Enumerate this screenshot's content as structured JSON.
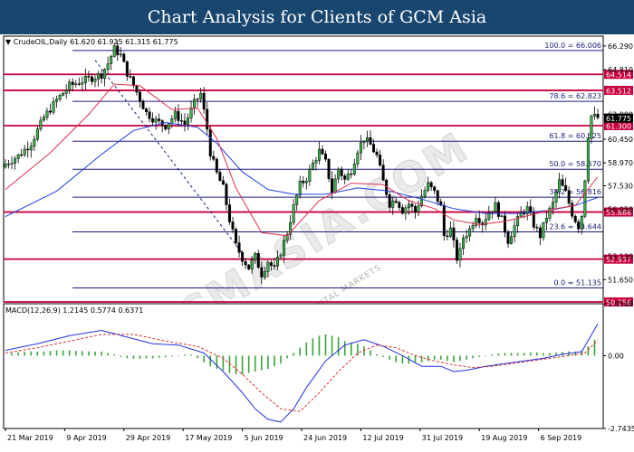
{
  "header": {
    "title": "Chart Analysis for Clients of GCM Asia"
  },
  "watermark": {
    "text": "GCMASIA.COM",
    "subtext": "GLOBAL CAPITAL MARKETS"
  },
  "chart_data": [
    {
      "type": "candlestick",
      "symbol_info": "CrudeOIL,Daily  61.620 61.915 61.315 61.775",
      "x_tick_labels": [
        "21 Mar 2019",
        "9 Apr 2019",
        "29 Apr 2019",
        "17 May 2019",
        "5 Jun 2019",
        "24 Jun 2019",
        "12 Jul 2019",
        "31 Jul 2019",
        "19 Aug 2019",
        "6 Sep 2019"
      ],
      "ylim": [
        50.256,
        66.906
      ],
      "y_tick_labels": [
        {
          "v": 66.29,
          "label": "66.290"
        },
        {
          "v": 64.81,
          "label": "64.810"
        },
        {
          "v": 62.0,
          "label": "62.000"
        },
        {
          "v": 60.45,
          "label": "60.450"
        },
        {
          "v": 58.97,
          "label": "58.970"
        },
        {
          "v": 57.53,
          "label": "57.530"
        },
        {
          "v": 56.05,
          "label": "56.050"
        },
        {
          "v": 53.13,
          "label": "53.130"
        },
        {
          "v": 51.65,
          "label": "51.650"
        }
      ],
      "current_price": {
        "v": 61.775,
        "label": "61.775",
        "color": "#000000"
      },
      "fib_levels": [
        {
          "v": 66.006,
          "label": "100.0 = 66.006"
        },
        {
          "v": 62.823,
          "label": "78.6 = 62.823"
        },
        {
          "v": 60.325,
          "label": "61.8 = 60.325"
        },
        {
          "v": 58.57,
          "label": "50.0 = 58.570"
        },
        {
          "v": 56.816,
          "label": "38.2 = 56.816"
        },
        {
          "v": 54.644,
          "label": "23.6 = 54.644"
        },
        {
          "v": 51.135,
          "label": "0.0 = 51.135"
        }
      ],
      "sr_levels": [
        {
          "v": 64.514,
          "label": "64.514"
        },
        {
          "v": 63.512,
          "label": "63.512"
        },
        {
          "v": 61.3,
          "label": "61.300"
        },
        {
          "v": 55.888,
          "label": "55.888"
        },
        {
          "v": 52.937,
          "label": "52.937"
        },
        {
          "v": 50.256,
          "label": "50.256"
        }
      ],
      "close_path": [
        [
          0,
          58.9
        ],
        [
          4,
          59.4
        ],
        [
          8,
          60.2
        ],
        [
          12,
          61.8
        ],
        [
          16,
          62.9
        ],
        [
          20,
          63.8
        ],
        [
          24,
          64.1
        ],
        [
          27,
          64.3
        ],
        [
          30,
          64.5
        ],
        [
          32,
          65.2
        ],
        [
          34,
          66.1
        ],
        [
          36,
          65.7
        ],
        [
          38,
          64.6
        ],
        [
          41,
          63.4
        ],
        [
          44,
          62.1
        ],
        [
          47,
          61.6
        ],
        [
          50,
          61.3
        ],
        [
          53,
          62.0
        ],
        [
          56,
          61.4
        ],
        [
          59,
          62.7
        ],
        [
          61,
          63.3
        ],
        [
          62,
          62.2
        ],
        [
          63,
          61.1
        ],
        [
          64,
          59.6
        ],
        [
          66,
          58.3
        ],
        [
          68,
          57.4
        ],
        [
          70,
          55.4
        ],
        [
          72,
          53.8
        ],
        [
          74,
          53.0
        ],
        [
          76,
          52.4
        ],
        [
          78,
          53.1
        ],
        [
          80,
          52.0
        ],
        [
          82,
          52.8
        ],
        [
          84,
          52.3
        ],
        [
          86,
          53.4
        ],
        [
          88,
          54.6
        ],
        [
          90,
          56.2
        ],
        [
          92,
          57.6
        ],
        [
          94,
          58.0
        ],
        [
          96,
          58.9
        ],
        [
          98,
          59.7
        ],
        [
          100,
          59.0
        ],
        [
          102,
          57.2
        ],
        [
          104,
          58.6
        ],
        [
          106,
          57.9
        ],
        [
          108,
          58.5
        ],
        [
          110,
          59.8
        ],
        [
          112,
          60.5
        ],
        [
          114,
          60.1
        ],
        [
          116,
          59.4
        ],
        [
          118,
          57.8
        ],
        [
          120,
          56.4
        ],
        [
          122,
          56.7
        ],
        [
          124,
          56.0
        ],
        [
          126,
          56.4
        ],
        [
          128,
          55.9
        ],
        [
          130,
          56.9
        ],
        [
          132,
          57.6
        ],
        [
          134,
          57.1
        ],
        [
          136,
          56.2
        ],
        [
          137,
          54.4
        ],
        [
          139,
          54.8
        ],
        [
          141,
          53.0
        ],
        [
          142,
          53.4
        ],
        [
          143,
          54.3
        ],
        [
          145,
          54.8
        ],
        [
          147,
          55.7
        ],
        [
          149,
          55.2
        ],
        [
          151,
          55.9
        ],
        [
          153,
          56.3
        ],
        [
          155,
          55.4
        ],
        [
          157,
          54.1
        ],
        [
          159,
          55.0
        ],
        [
          161,
          55.8
        ],
        [
          163,
          56.1
        ],
        [
          165,
          55.1
        ],
        [
          167,
          54.4
        ],
        [
          169,
          55.6
        ],
        [
          171,
          56.4
        ],
        [
          173,
          57.8
        ],
        [
          175,
          57.1
        ],
        [
          177,
          55.8
        ],
        [
          179,
          55.0
        ],
        [
          180,
          55.7
        ],
        [
          181,
          58.0
        ],
        [
          182,
          60.7
        ],
        [
          183,
          61.9
        ],
        [
          185,
          61.8
        ]
      ],
      "ma_red": [
        [
          0,
          57.3
        ],
        [
          14,
          59.6
        ],
        [
          26,
          62.0
        ],
        [
          34,
          63.9
        ],
        [
          42,
          63.8
        ],
        [
          52,
          62.3
        ],
        [
          60,
          62.4
        ],
        [
          66,
          60.5
        ],
        [
          72,
          57.4
        ],
        [
          80,
          54.6
        ],
        [
          88,
          54.4
        ],
        [
          98,
          56.6
        ],
        [
          108,
          57.7
        ],
        [
          118,
          57.6
        ],
        [
          126,
          56.6
        ],
        [
          134,
          56.1
        ],
        [
          140,
          55.4
        ],
        [
          148,
          55.1
        ],
        [
          156,
          55.3
        ],
        [
          164,
          55.7
        ],
        [
          172,
          56.1
        ],
        [
          178,
          56.3
        ],
        [
          185,
          58.1
        ]
      ],
      "ma_blue": [
        [
          0,
          55.6
        ],
        [
          16,
          57.2
        ],
        [
          30,
          59.5
        ],
        [
          40,
          61.0
        ],
        [
          50,
          61.5
        ],
        [
          60,
          61.2
        ],
        [
          66,
          60.2
        ],
        [
          74,
          58.4
        ],
        [
          82,
          57.3
        ],
        [
          90,
          57.0
        ],
        [
          100,
          57.0
        ],
        [
          110,
          57.4
        ],
        [
          120,
          57.2
        ],
        [
          130,
          56.7
        ],
        [
          140,
          56.1
        ],
        [
          150,
          55.8
        ],
        [
          160,
          55.8
        ],
        [
          170,
          56.0
        ],
        [
          178,
          56.3
        ],
        [
          185,
          56.8
        ]
      ],
      "dashed_trend": [
        [
          28,
          65.4
        ],
        [
          74,
          53.3
        ]
      ]
    },
    {
      "type": "macd",
      "label": "MACD(12,26,9) 1.2145 0.5774 0.6371",
      "ylim": [
        -2.7435,
        1.9548
      ],
      "y_tick_labels": [
        {
          "v": 1.9548,
          "label": "1.9548"
        },
        {
          "v": 0.0,
          "label": "0.00"
        },
        {
          "v": -2.7435,
          "label": "-2.7435"
        }
      ],
      "macd": [
        [
          0,
          0.2
        ],
        [
          10,
          0.45
        ],
        [
          20,
          0.75
        ],
        [
          30,
          0.95
        ],
        [
          38,
          0.7
        ],
        [
          46,
          0.45
        ],
        [
          54,
          0.4
        ],
        [
          62,
          0.1
        ],
        [
          68,
          -0.6
        ],
        [
          74,
          -1.4
        ],
        [
          78,
          -2.0
        ],
        [
          82,
          -2.4
        ],
        [
          86,
          -2.5
        ],
        [
          90,
          -2.0
        ],
        [
          94,
          -1.2
        ],
        [
          100,
          -0.2
        ],
        [
          106,
          0.4
        ],
        [
          112,
          0.6
        ],
        [
          118,
          0.35
        ],
        [
          124,
          0.0
        ],
        [
          130,
          -0.4
        ],
        [
          136,
          -0.4
        ],
        [
          140,
          -0.6
        ],
        [
          144,
          -0.55
        ],
        [
          150,
          -0.4
        ],
        [
          156,
          -0.3
        ],
        [
          162,
          -0.2
        ],
        [
          168,
          -0.1
        ],
        [
          174,
          0.05
        ],
        [
          180,
          0.15
        ],
        [
          185,
          1.2
        ]
      ],
      "signal": [
        [
          0,
          0.1
        ],
        [
          10,
          0.3
        ],
        [
          20,
          0.55
        ],
        [
          30,
          0.8
        ],
        [
          40,
          0.8
        ],
        [
          50,
          0.55
        ],
        [
          60,
          0.35
        ],
        [
          68,
          -0.1
        ],
        [
          74,
          -0.7
        ],
        [
          80,
          -1.4
        ],
        [
          86,
          -2.0
        ],
        [
          92,
          -2.1
        ],
        [
          98,
          -1.4
        ],
        [
          104,
          -0.6
        ],
        [
          110,
          0.1
        ],
        [
          116,
          0.4
        ],
        [
          122,
          0.3
        ],
        [
          128,
          0.0
        ],
        [
          134,
          -0.2
        ],
        [
          140,
          -0.35
        ],
        [
          146,
          -0.45
        ],
        [
          152,
          -0.4
        ],
        [
          158,
          -0.3
        ],
        [
          164,
          -0.2
        ],
        [
          170,
          -0.1
        ],
        [
          176,
          0.0
        ],
        [
          181,
          0.1
        ],
        [
          185,
          0.58
        ]
      ],
      "histogram": [
        [
          2,
          0.1
        ],
        [
          4,
          0.12
        ],
        [
          6,
          0.14
        ],
        [
          8,
          0.16
        ],
        [
          10,
          0.15
        ],
        [
          12,
          0.16
        ],
        [
          14,
          0.18
        ],
        [
          16,
          0.2
        ],
        [
          18,
          0.2
        ],
        [
          20,
          0.2
        ],
        [
          22,
          0.18
        ],
        [
          24,
          0.17
        ],
        [
          26,
          0.16
        ],
        [
          28,
          0.15
        ],
        [
          30,
          0.15
        ],
        [
          32,
          0.1
        ],
        [
          34,
          0.05
        ],
        [
          36,
          -0.05
        ],
        [
          38,
          -0.1
        ],
        [
          40,
          -0.12
        ],
        [
          42,
          -0.12
        ],
        [
          44,
          -0.1
        ],
        [
          46,
          -0.1
        ],
        [
          48,
          -0.08
        ],
        [
          50,
          -0.06
        ],
        [
          52,
          -0.04
        ],
        [
          54,
          0.02
        ],
        [
          56,
          0.05
        ],
        [
          58,
          0.04
        ],
        [
          60,
          -0.1
        ],
        [
          62,
          -0.25
        ],
        [
          64,
          -0.4
        ],
        [
          66,
          -0.5
        ],
        [
          68,
          -0.55
        ],
        [
          70,
          -0.65
        ],
        [
          72,
          -0.7
        ],
        [
          74,
          -0.72
        ],
        [
          76,
          -0.65
        ],
        [
          78,
          -0.6
        ],
        [
          80,
          -0.55
        ],
        [
          82,
          -0.5
        ],
        [
          84,
          -0.4
        ],
        [
          86,
          -0.3
        ],
        [
          88,
          -0.1
        ],
        [
          90,
          0.1
        ],
        [
          92,
          0.3
        ],
        [
          94,
          0.5
        ],
        [
          96,
          0.65
        ],
        [
          98,
          0.75
        ],
        [
          100,
          0.8
        ],
        [
          102,
          0.75
        ],
        [
          104,
          0.7
        ],
        [
          106,
          0.55
        ],
        [
          108,
          0.5
        ],
        [
          110,
          0.45
        ],
        [
          112,
          0.35
        ],
        [
          114,
          0.2
        ],
        [
          116,
          0.05
        ],
        [
          118,
          -0.05
        ],
        [
          120,
          -0.15
        ],
        [
          122,
          -0.25
        ],
        [
          124,
          -0.3
        ],
        [
          126,
          -0.3
        ],
        [
          128,
          -0.25
        ],
        [
          130,
          -0.25
        ],
        [
          132,
          -0.2
        ],
        [
          134,
          -0.15
        ],
        [
          136,
          -0.15
        ],
        [
          138,
          -0.2
        ],
        [
          140,
          -0.25
        ],
        [
          142,
          -0.2
        ],
        [
          144,
          -0.15
        ],
        [
          146,
          -0.1
        ],
        [
          148,
          -0.05
        ],
        [
          150,
          0.0
        ],
        [
          152,
          0.05
        ],
        [
          154,
          0.08
        ],
        [
          156,
          0.1
        ],
        [
          158,
          0.1
        ],
        [
          160,
          0.1
        ],
        [
          162,
          0.1
        ],
        [
          164,
          0.12
        ],
        [
          166,
          0.12
        ],
        [
          168,
          0.1
        ],
        [
          170,
          0.1
        ],
        [
          172,
          0.12
        ],
        [
          174,
          0.14
        ],
        [
          176,
          0.16
        ],
        [
          178,
          0.15
        ],
        [
          180,
          0.2
        ],
        [
          182,
          0.35
        ],
        [
          184,
          0.6
        ]
      ]
    }
  ],
  "colors": {
    "fib_line": "#1a1a7a",
    "sr_line": "#c8003c",
    "ma_red": "#e03050",
    "ma_blue": "#2040e0",
    "candle": "#000000",
    "bull": "#3bb34a",
    "macd_line": "#2030e0",
    "signal_line": "#e03030",
    "histogram": "#3aa33a"
  }
}
